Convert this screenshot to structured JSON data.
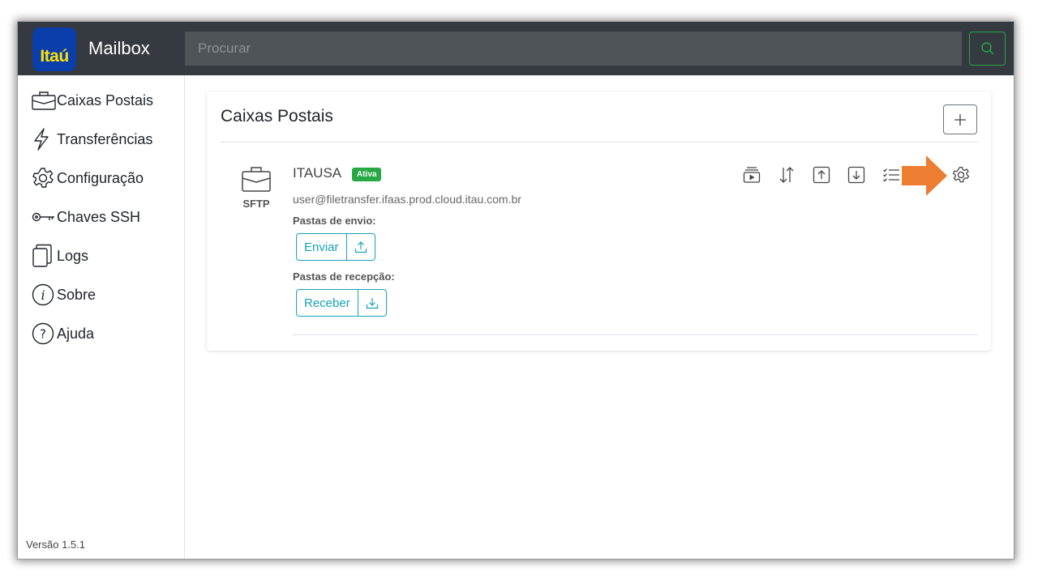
{
  "app": {
    "logo_text": "Itaú",
    "title": "Mailbox"
  },
  "search": {
    "placeholder": "Procurar",
    "value": ""
  },
  "sidebar": {
    "items": [
      {
        "label": "Caixas Postais",
        "icon": "briefcase-icon"
      },
      {
        "label": "Transferências",
        "icon": "lightning-icon"
      },
      {
        "label": "Configuração",
        "icon": "gear-icon"
      },
      {
        "label": "Chaves SSH",
        "icon": "key-icon"
      },
      {
        "label": "Logs",
        "icon": "files-icon"
      },
      {
        "label": "Sobre",
        "icon": "info-icon"
      },
      {
        "label": "Ajuda",
        "icon": "question-icon"
      }
    ],
    "version": "Versão 1.5.1"
  },
  "main": {
    "title": "Caixas Postais",
    "add_button": "+",
    "mailbox": {
      "protocol": "SFTP",
      "name": "ITAUSA",
      "status": "Ativa",
      "user": "user@filetransfer.ifaas.prod.cloud.itau.com.br",
      "send_label": "Pastas de envio:",
      "send_button": "Enviar",
      "receive_label": "Pastas de recepção:",
      "receive_button": "Receber",
      "actions": [
        "play-stack-icon",
        "transfer-arrows-icon",
        "upload-box-icon",
        "download-box-icon",
        "checklist-icon",
        "gear-icon"
      ]
    }
  },
  "colors": {
    "topbar": "#343a40",
    "success": "#28a745",
    "info": "#17a2b8",
    "annotation_arrow": "#ed7d31",
    "logo_bg": "#0a3eaa",
    "logo_text": "#ffe000"
  }
}
